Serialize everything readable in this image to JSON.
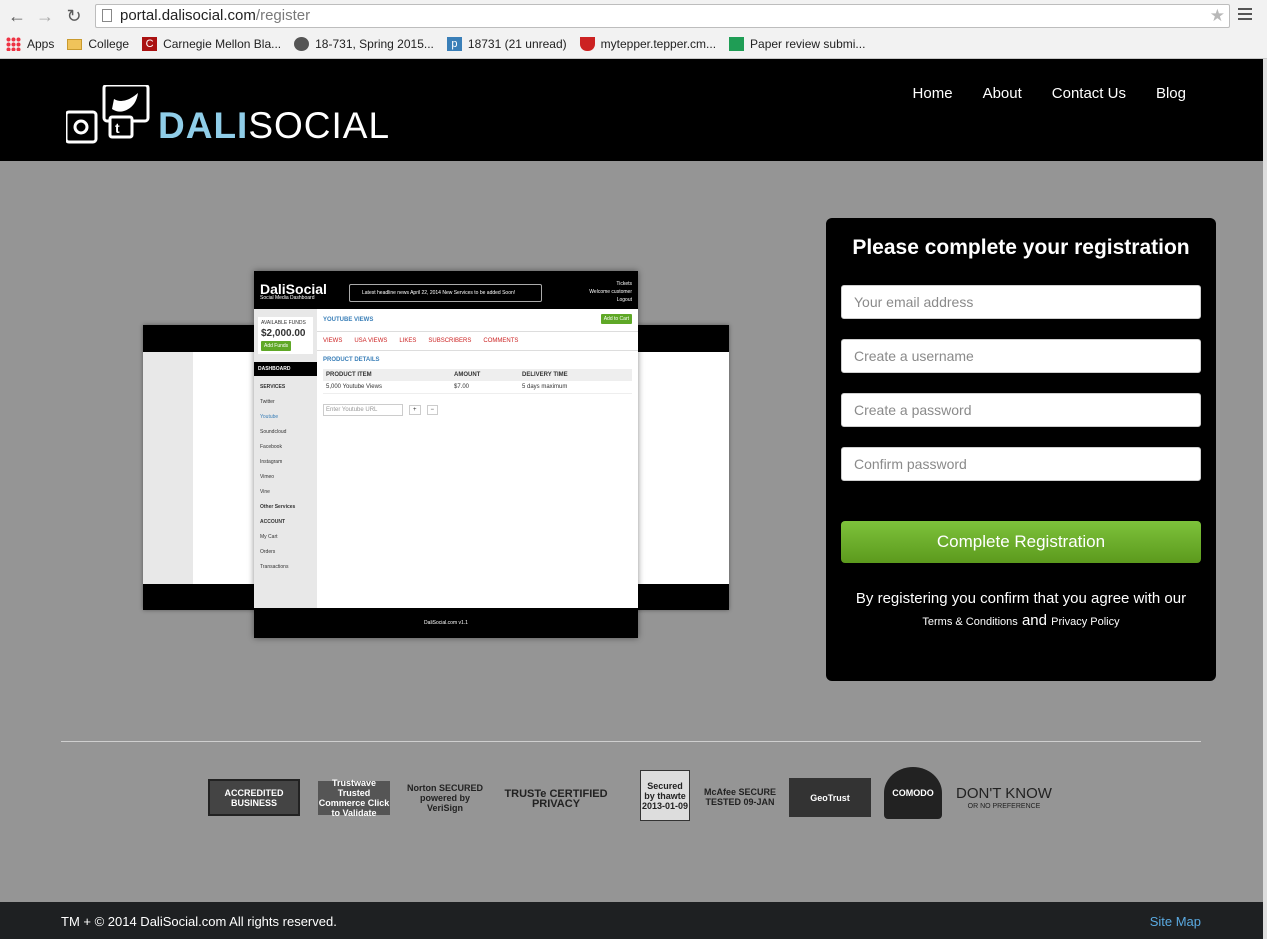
{
  "browser": {
    "url_host": "portal.dalisocial.com",
    "url_path": "/register",
    "bookmarks": [
      {
        "label": "Apps",
        "icon": "apps-grid-icon"
      },
      {
        "label": "College",
        "icon": "folder-icon"
      },
      {
        "label": "Carnegie Mellon Bla...",
        "icon": "blackboard-icon"
      },
      {
        "label": "18-731, Spring 2015...",
        "icon": "course-icon"
      },
      {
        "label": "18731 (21 unread)",
        "icon": "piazza-icon"
      },
      {
        "label": "mytepper.tepper.cm...",
        "icon": "tepper-icon"
      },
      {
        "label": "Paper review submi...",
        "icon": "sheet-icon"
      }
    ]
  },
  "header": {
    "logo_part1": "DALI",
    "logo_part2": "SOCIAL",
    "nav": [
      "Home",
      "About",
      "Contact Us",
      "Blog"
    ]
  },
  "mockup": {
    "brand": "DaliSocial",
    "brand_sub": "Social Media Dashboard",
    "news": "Latest headline news  April 22, 2014 New Services to be added Soon!",
    "user": [
      "Tickets",
      "Welcome customer",
      "Logout"
    ],
    "funds_label": "AVAILABLE FUNDS",
    "funds_value": "$2,000.00",
    "add_funds": "Add Funds",
    "dashboard": "DASHBOARD",
    "services_label": "SERVICES",
    "services": [
      "Twitter",
      "Youtube",
      "Soundcloud",
      "Facebook",
      "Instagram",
      "Vimeo",
      "Vine"
    ],
    "other_services": "Other Services",
    "account_label": "ACCOUNT",
    "account": [
      "My Cart",
      "Orders",
      "Transactions"
    ],
    "section_title": "YOUTUBE VIEWS",
    "add_cart": "Add to Cart",
    "tabs": [
      "VIEWS",
      "USA VIEWS",
      "LIKES",
      "SUBSCRIBERS",
      "COMMENTS"
    ],
    "product_details": "PRODUCT DETAILS",
    "table_headers": [
      "PRODUCT ITEM",
      "AMOUNT",
      "DELIVERY TIME"
    ],
    "table_row": [
      "5,000 Youtube Views",
      "$7.00",
      "5 days maximum"
    ],
    "url_placeholder": "Enter Youtube URL",
    "footer": "DaliSocial.com v1.1"
  },
  "registration": {
    "title": "Please complete your registration",
    "email_placeholder": "Your email address",
    "username_placeholder": "Create a username",
    "password_placeholder": "Create a password",
    "confirm_placeholder": "Confirm password",
    "submit": "Complete Registration",
    "note": "By registering you confirm that you agree with our",
    "terms": "Terms & Conditions",
    "and": "and",
    "privacy": "Privacy Policy"
  },
  "badges": [
    "ACCREDITED BUSINESS",
    "Trustwave Trusted Commerce Click to Validate",
    "Norton SECURED powered by VeriSign",
    "TRUSTe CERTIFIED PRIVACY",
    "Secured by thawte 2013-01-09",
    "McAfee SECURE TESTED 09-JAN",
    "GeoTrust",
    "COMODO",
    "DON'T KNOW",
    "OR NO PREFERENCE"
  ],
  "footer": {
    "copyright": "TM + © 2014 DaliSocial.com All rights reserved.",
    "sitemap": "Site Map"
  },
  "colors": {
    "accent_green": "#5fa827",
    "logo_blue": "#8fcde8",
    "link_blue": "#5aa9e0"
  }
}
